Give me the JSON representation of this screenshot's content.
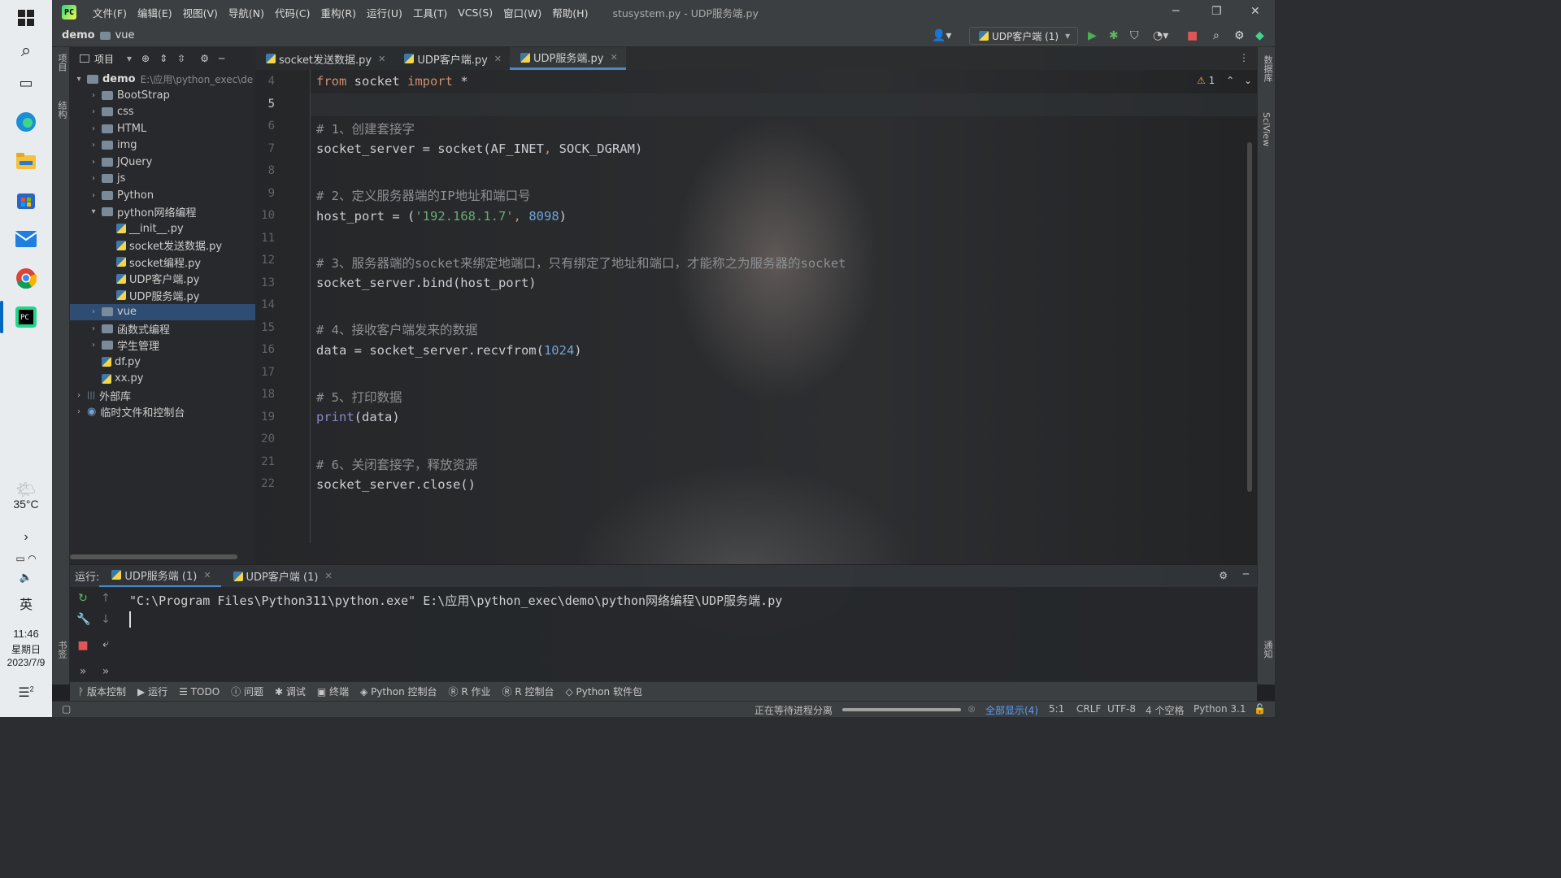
{
  "taskbar": {
    "weather_temp": "35°C",
    "ime": "英",
    "time": "11:46",
    "weekday": "星期日",
    "date": "2023/7/9",
    "notif_count": "2"
  },
  "window": {
    "title": "stusystem.py - UDP服务端.py",
    "menu": [
      "文件(F)",
      "编辑(E)",
      "视图(V)",
      "导航(N)",
      "代码(C)",
      "重构(R)",
      "运行(U)",
      "工具(T)",
      "VCS(S)",
      "窗口(W)",
      "帮助(H)"
    ]
  },
  "breadcrumb": {
    "root": "demo",
    "child": "vue"
  },
  "run_config": "UDP客户端 (1)",
  "left_strip": {
    "project": "项目",
    "structure": "结构",
    "bookmarks": "书签"
  },
  "right_strip": {
    "database": "数据库",
    "sciview": "SciView",
    "notifications": "通知"
  },
  "project": {
    "label": "项目",
    "root": {
      "name": "demo",
      "path": "E:\\应用\\python_exec\\de"
    },
    "items": [
      {
        "name": "BootStrap",
        "type": "folder"
      },
      {
        "name": "css",
        "type": "folder"
      },
      {
        "name": "HTML",
        "type": "folder"
      },
      {
        "name": "img",
        "type": "folder"
      },
      {
        "name": "JQuery",
        "type": "folder"
      },
      {
        "name": "js",
        "type": "folder"
      },
      {
        "name": "Python",
        "type": "folder"
      },
      {
        "name": "python网络编程",
        "type": "folder"
      },
      {
        "name": "__init__.py",
        "type": "file"
      },
      {
        "name": "socket发送数据.py",
        "type": "file"
      },
      {
        "name": "socket编程.py",
        "type": "file"
      },
      {
        "name": "UDP客户端.py",
        "type": "file"
      },
      {
        "name": "UDP服务端.py",
        "type": "file"
      },
      {
        "name": "vue",
        "type": "folder"
      },
      {
        "name": "函数式编程",
        "type": "folder"
      },
      {
        "name": "学生管理",
        "type": "folder"
      },
      {
        "name": "df.py",
        "type": "file"
      },
      {
        "name": "xx.py",
        "type": "file"
      },
      {
        "name": "外部库",
        "type": "lib"
      },
      {
        "name": "临时文件和控制台",
        "type": "scratch"
      }
    ]
  },
  "tabs": [
    "socket发送数据.py",
    "UDP客户端.py",
    "UDP服务端.py"
  ],
  "inspection": "1",
  "code_lines": [
    "4",
    "5",
    "6",
    "7",
    "8",
    "9",
    "10",
    "11",
    "12",
    "13",
    "14",
    "15",
    "16",
    "17",
    "18",
    "19",
    "20",
    "21",
    "22"
  ],
  "code": {
    "l4_kw1": "from",
    "l4_mod": " socket ",
    "l4_kw2": "import",
    "l4_star": " *",
    "c1": "# 1、创建套接字",
    "l7_a": "socket_server = socket(AF_INET",
    "l7_b": ", ",
    "l7_c": "SOCK_DGRAM)",
    "c2": "# 2、定义服务器端的IP地址和端口号",
    "l10_a": "host_port = (",
    "l10_str": "'192.168.1.7'",
    "l10_b": ", ",
    "l10_num": "8098",
    "l10_c": ")",
    "c3": "# 3、服务器端的socket来绑定地端口，只有绑定了地址和端口，才能称之为服务器的socket",
    "l13": "socket_server.bind(host_port)",
    "c4": "# 4、接收客户端发来的数据",
    "l16_a": "data = socket_server.recvfrom(",
    "l16_num": "1024",
    "l16_b": ")",
    "c5": "# 5、打印数据",
    "l19_fn": "print",
    "l19_a": "(data)",
    "c6": "# 6、关闭套接字，释放资源",
    "l22": "socket_server.close()"
  },
  "run": {
    "label": "运行:",
    "tabs": [
      "UDP服务端 (1)",
      "UDP客户端 (1)"
    ],
    "console": "\"C:\\Program Files\\Python311\\python.exe\" E:\\应用\\python_exec\\demo\\python网络编程\\UDP服务端.py"
  },
  "tool_tabs": [
    "版本控制",
    "运行",
    "TODO",
    "问题",
    "调试",
    "终端",
    "Python 控制台",
    "R 作业",
    "R 控制台",
    "Python 软件包"
  ],
  "status": {
    "process": "正在等待进程分离",
    "progress": 1.0,
    "show_all": "全部显示(4)",
    "position": "5:1",
    "line_sep": "CRLF",
    "encoding": "UTF-8",
    "indent": "4 个空格",
    "interpreter": "Python 3.1"
  },
  "colors": {
    "accent": "#4a88c7",
    "selected": "#2f4d73",
    "keyword": "#cf8e6d",
    "string": "#6aab73",
    "number": "#6fa4d8",
    "comment": "#8d8f93"
  }
}
